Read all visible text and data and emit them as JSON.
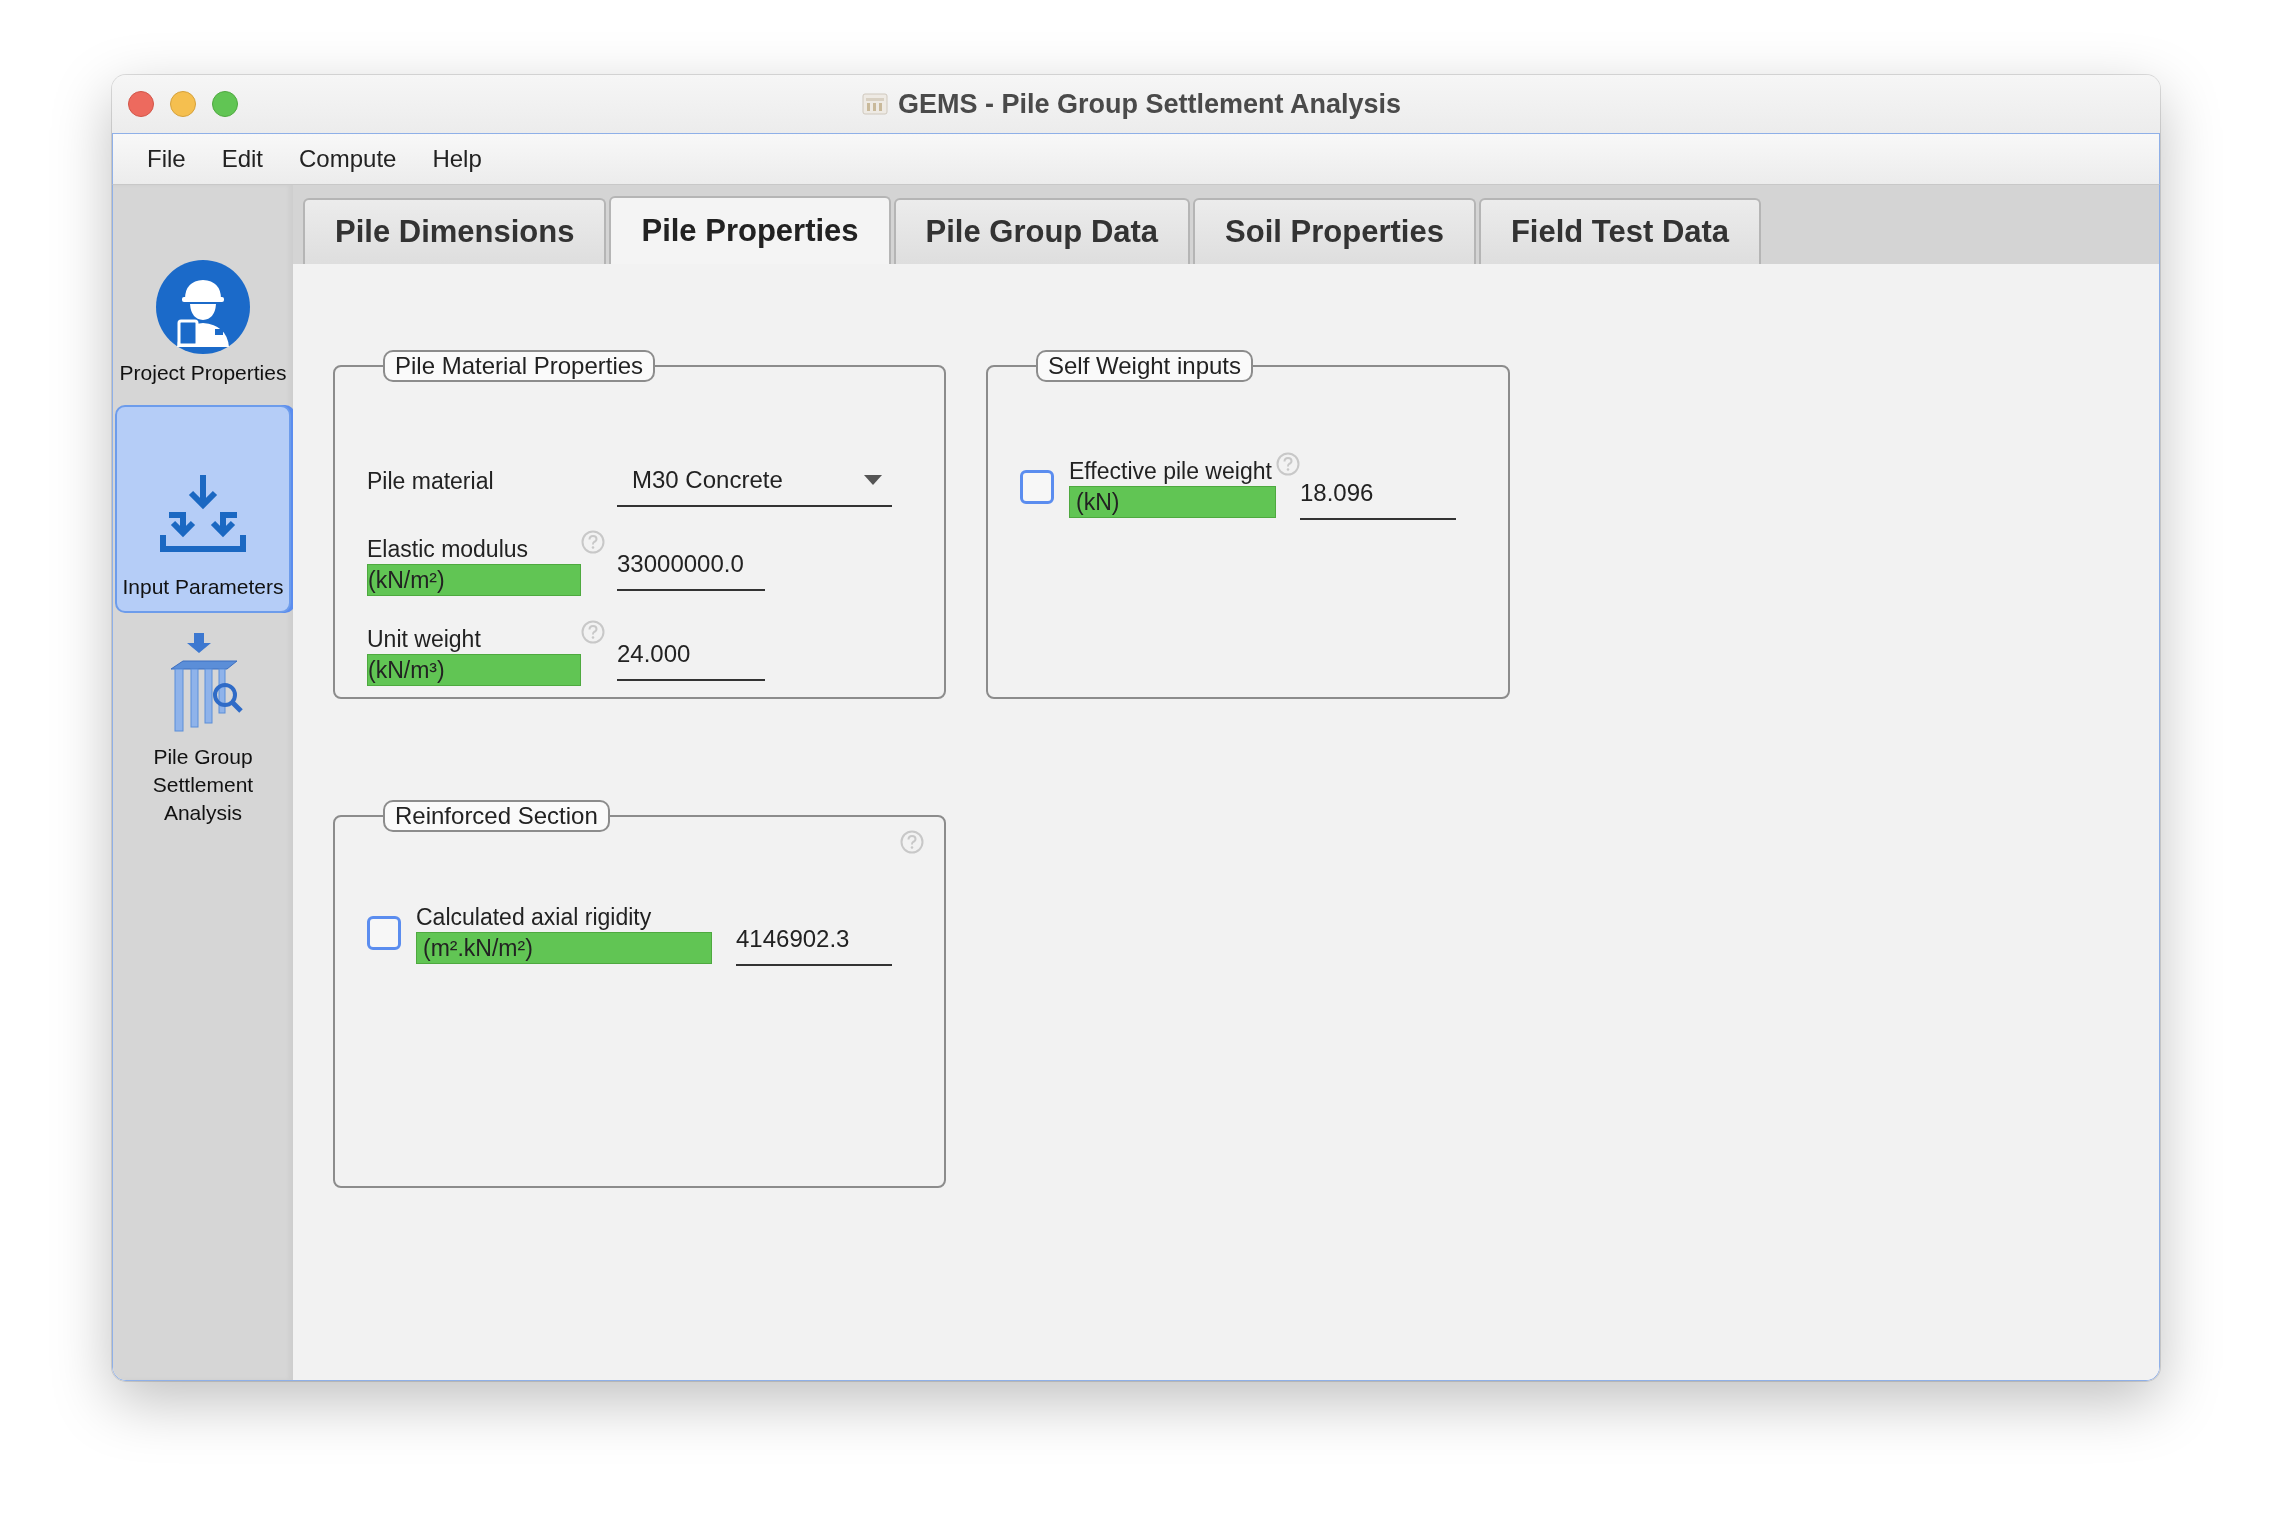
{
  "window": {
    "title": "GEMS - Pile Group Settlement Analysis"
  },
  "menu": [
    "File",
    "Edit",
    "Compute",
    "Help"
  ],
  "sidebar": {
    "items": [
      {
        "label": "Project Properties",
        "kind": "project",
        "selected": false
      },
      {
        "label": "Input Parameters",
        "kind": "input",
        "selected": true
      },
      {
        "label": "Pile Group Settlement Analysis",
        "kind": "analysis",
        "selected": false
      }
    ]
  },
  "tabs": [
    {
      "label": "Pile Dimensions",
      "selected": false
    },
    {
      "label": "Pile Properties",
      "selected": true
    },
    {
      "label": "Pile Group Data",
      "selected": false
    },
    {
      "label": "Soil Properties",
      "selected": false
    },
    {
      "label": "Field Test Data",
      "selected": false
    }
  ],
  "panels": [
    {
      "title": "Pile Material Properties",
      "help": false,
      "rows": [
        {
          "kind": "dropdown",
          "label": [
            "Pile material"
          ],
          "value": "M30 Concrete",
          "help": false
        },
        {
          "kind": "field",
          "label": [
            "Elastic modulus",
            "(kN/m²)"
          ],
          "value": "33000000.0",
          "help": true
        },
        {
          "kind": "field",
          "label": [
            "Unit weight",
            "(kN/m³)"
          ],
          "value": "24.000",
          "help": true
        }
      ]
    },
    {
      "title": "Self Weight inputs",
      "help": false,
      "rows": [
        {
          "kind": "checkbox",
          "checked": false,
          "label": [
            "Effective pile weight",
            "(kN)"
          ],
          "value": "18.096",
          "help": true
        }
      ]
    },
    {
      "title": "Reinforced Section",
      "help": true,
      "rows": [
        {
          "kind": "checkbox",
          "checked": false,
          "label": [
            "Calculated axial rigidity",
            "(m².kN/m²)"
          ],
          "value": "4146902.3",
          "help": false
        }
      ]
    }
  ]
}
